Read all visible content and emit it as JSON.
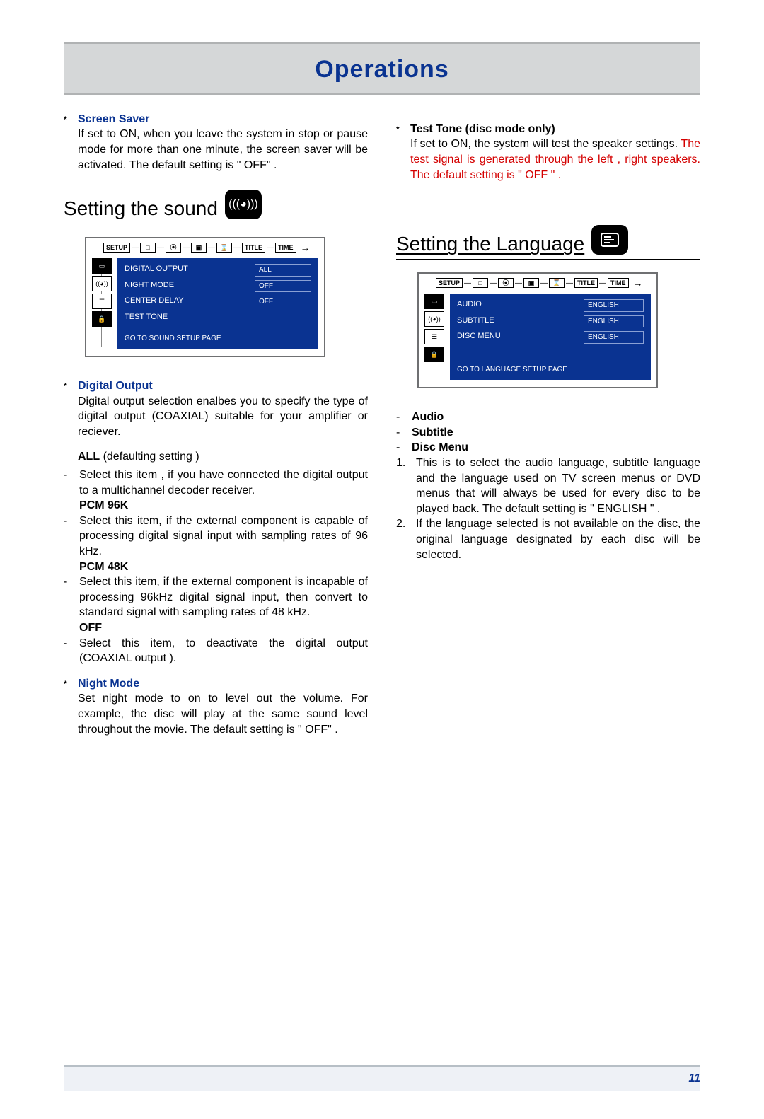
{
  "banner": {
    "title": "Operations"
  },
  "left": {
    "screen_saver": {
      "heading": "Screen Saver",
      "text": "If set to ON, when you leave the system in stop or pause mode for more than one minute, the screen saver will be activated. The default setting is \" OFF\" ."
    },
    "section": {
      "title": "Setting the sound",
      "icon_name": "surround-sound-icon"
    },
    "osd": {
      "tabs": [
        "SETUP",
        "□",
        "⦿",
        "▣",
        "⌛",
        "TITLE",
        "TIME"
      ],
      "side_icons": [
        "tv-icon",
        "surround-icon",
        "language-icon",
        "lock-icon"
      ],
      "rows": [
        {
          "label": "DIGITAL OUTPUT",
          "value": "ALL"
        },
        {
          "label": "NIGHT MODE",
          "value": "OFF"
        },
        {
          "label": "CENTER DELAY",
          "value": "OFF"
        },
        {
          "label": "TEST TONE",
          "value": ""
        }
      ],
      "footer": "GO TO SOUND SETUP PAGE"
    },
    "digital_output": {
      "heading": "Digital Output",
      "intro": "Digital output selection enalbes you to specify the type of digital output (COAXIAL) suitable for your amplifier or reciever.",
      "all_label": "ALL",
      "all_note": "(defaulting setting )",
      "all_text": "Select this item , if you have connected the digital output to a multichannel decoder receiver.",
      "pcm96_label": "PCM 96K",
      "pcm96_text": "Select this item, if the external component is capable of processing digital signal input with sampling rates of 96 kHz.",
      "pcm48_label": "PCM 48K",
      "pcm48_text": "Select this item, if the external component is incapable of processing 96kHz digital signal input, then convert to standard signal with sampling rates of 48 kHz.",
      "off_label": "OFF",
      "off_text": "Select this item,  to deactivate the digital output (COAXIAL  output )."
    },
    "night_mode": {
      "heading": "Night Mode",
      "text": "Set night mode to on to level out the volume. For example, the disc will play at the same sound level throughout the movie. The default setting is \" OFF\" ."
    }
  },
  "right": {
    "test_tone": {
      "heading": "Test Tone (disc mode only)",
      "text_black": "If set to ON, the system will test the speaker settings. ",
      "text_red": "The test signal is generated through the left , right speakers. The default setting is \" OFF \" ."
    },
    "section": {
      "title": "Setting the Language",
      "icon_name": "language-icon"
    },
    "osd": {
      "tabs": [
        "SETUP",
        "□",
        "⦿",
        "▣",
        "⌛",
        "TITLE",
        "TIME"
      ],
      "side_icons": [
        "tv-icon",
        "surround-icon",
        "language-icon",
        "lock-icon"
      ],
      "rows": [
        {
          "label": "AUDIO",
          "value": "ENGLISH"
        },
        {
          "label": "SUBTITLE",
          "value": "ENGLISH"
        },
        {
          "label": "DISC MENU",
          "value": "ENGLISH"
        }
      ],
      "footer": "GO TO LANGUAGE SETUP PAGE"
    },
    "lang_items": {
      "i1": "Audio",
      "i2": "Subtitle",
      "i3": "Disc Menu",
      "n1": "This is to select the audio language, subtitle language and the language used on TV screen menus or DVD menus that will always be used for every disc to be played back. The default setting is \" ENGLISH \" .",
      "n2": "If the language selected is not available on the disc, the original language designated by each disc will be selected."
    }
  },
  "page_number": "11"
}
